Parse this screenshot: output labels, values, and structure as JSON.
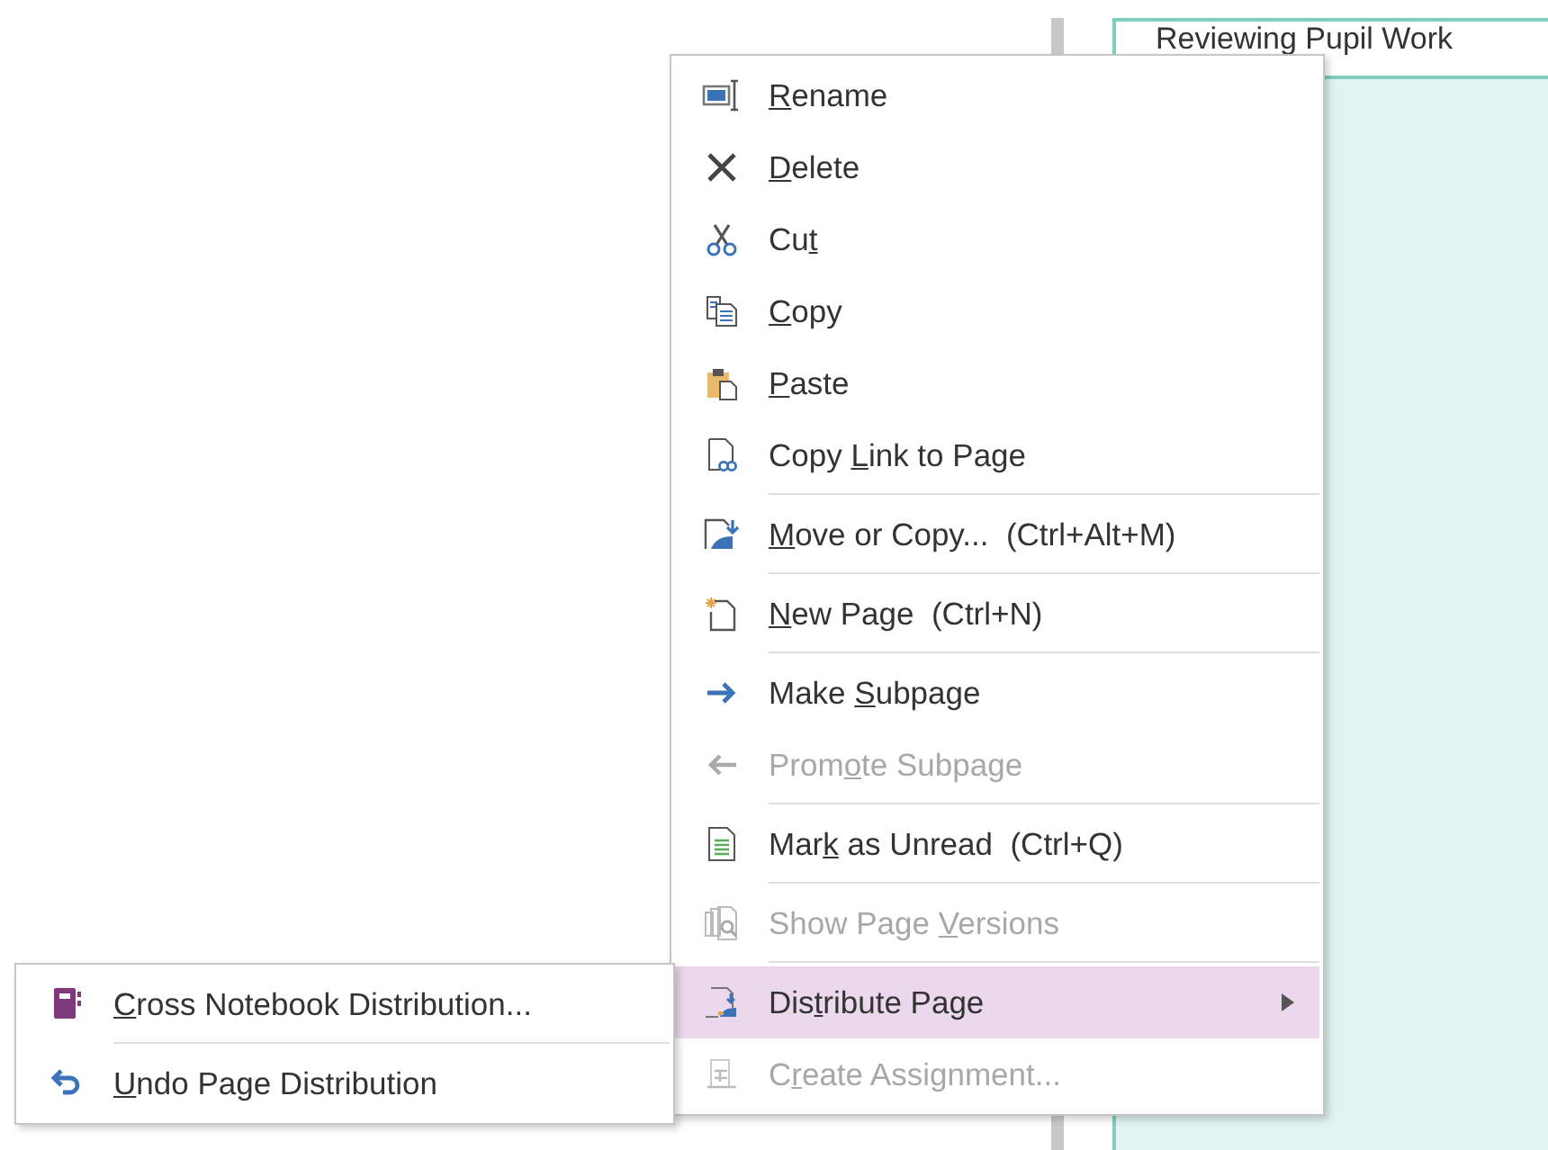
{
  "page_tab": {
    "title": "Reviewing Pupil Work"
  },
  "context_menu": {
    "items": [
      {
        "access_key": "R",
        "text_after": "ename",
        "disabled": false,
        "selected": false
      },
      {
        "access_key": "D",
        "text_after": "elete",
        "disabled": false,
        "selected": false
      },
      {
        "text_before": "Cu",
        "access_key": "t",
        "disabled": false,
        "selected": false
      },
      {
        "access_key": "C",
        "text_after": "opy",
        "disabled": false,
        "selected": false
      },
      {
        "access_key": "P",
        "text_after": "aste",
        "disabled": false,
        "selected": false
      },
      {
        "text_before": "Copy ",
        "access_key": "L",
        "text_after": "ink to Page",
        "disabled": false,
        "selected": false
      },
      {
        "access_key": "M",
        "text_after": "ove or Copy...",
        "shortcut": "(Ctrl+Alt+M)",
        "separator_before": true,
        "disabled": false,
        "selected": false
      },
      {
        "access_key": "N",
        "text_after": "ew Page",
        "shortcut": "(Ctrl+N)",
        "separator_before": true,
        "disabled": false,
        "selected": false
      },
      {
        "text_before": "Make ",
        "access_key": "S",
        "text_after": "ubpage",
        "separator_before": true,
        "disabled": false,
        "selected": false
      },
      {
        "text_before": "Prom",
        "access_key": "o",
        "text_after": "te Subpage",
        "disabled": true,
        "selected": false
      },
      {
        "text_before": "Mar",
        "access_key": "k",
        "text_after": " as Unread",
        "shortcut": "(Ctrl+Q)",
        "separator_before": true,
        "disabled": false,
        "selected": false
      },
      {
        "text_before": "Show Page ",
        "access_key": "V",
        "text_after": "ersions",
        "separator_before": true,
        "disabled": true,
        "selected": false
      },
      {
        "text_before": "Dis",
        "access_key": "t",
        "text_after": "ribute Page",
        "submenu": true,
        "separator_before": true,
        "disabled": false,
        "selected": true
      },
      {
        "text_before": "C",
        "access_key": "r",
        "text_after": "eate Assignment...",
        "disabled": true,
        "selected": false
      }
    ]
  },
  "submenu": {
    "items": [
      {
        "access_key": "C",
        "text_after": "ross Notebook Distribution...",
        "disabled": false,
        "selected": false
      },
      {
        "access_key": "U",
        "text_after": "ndo Page Distribution",
        "separator_before": true,
        "disabled": false,
        "selected": false
      }
    ]
  }
}
